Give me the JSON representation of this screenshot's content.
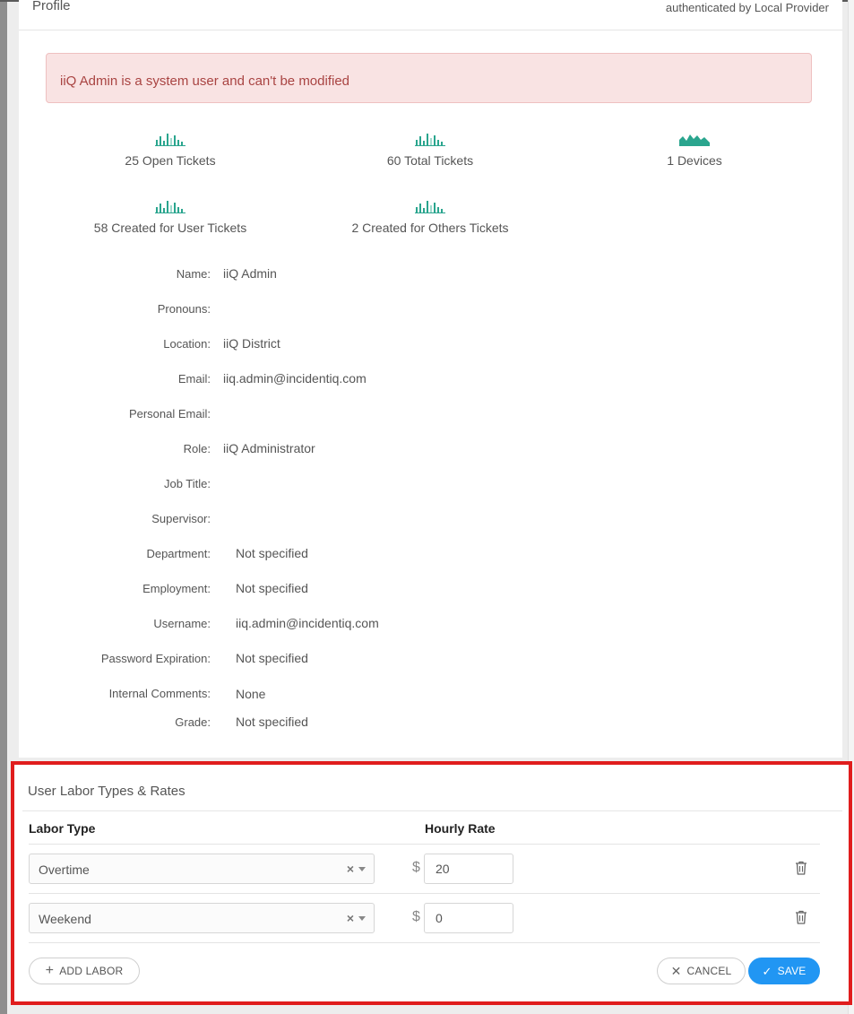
{
  "profile": {
    "title": "Profile",
    "auth": "authenticated by Local Provider",
    "alert": "iiQ Admin is a system user and can't be modified"
  },
  "stats": [
    {
      "label": "25 Open Tickets",
      "icon": "bar-chart-icon"
    },
    {
      "label": "60 Total Tickets",
      "icon": "bar-chart-icon"
    },
    {
      "label": "1 Devices",
      "icon": "area-chart-icon"
    },
    {
      "label": "58 Created for User Tickets",
      "icon": "bar-chart-icon"
    },
    {
      "label": "2 Created for Others Tickets",
      "icon": "bar-chart-icon"
    }
  ],
  "fields": [
    {
      "label": "Name:",
      "value": "iiQ Admin"
    },
    {
      "label": "Pronouns:",
      "value": ""
    },
    {
      "label": "Location:",
      "value": "iiQ District"
    },
    {
      "label": "Email:",
      "value": "iiq.admin@incidentiq.com"
    },
    {
      "label": "Personal Email:",
      "value": ""
    },
    {
      "label": "Role:",
      "value": "iiQ Administrator"
    },
    {
      "label": "Job Title:",
      "value": ""
    },
    {
      "label": "Supervisor:",
      "value": ""
    },
    {
      "label": "Department:",
      "value": "Not specified"
    },
    {
      "label": "Employment:",
      "value": "Not specified"
    },
    {
      "label": "Username:",
      "value": "iiq.admin@incidentiq.com"
    },
    {
      "label": "Password Expiration:",
      "value": "Not specified"
    },
    {
      "label": "Internal Comments:",
      "value": "None"
    },
    {
      "label": "Grade:",
      "value": "Not specified"
    }
  ],
  "labor": {
    "title": "User Labor Types & Rates",
    "col_type": "Labor Type",
    "col_rate": "Hourly Rate",
    "currency": "$",
    "rows": [
      {
        "type": "Overtime",
        "rate": "20"
      },
      {
        "type": "Weekend",
        "rate": "0"
      }
    ],
    "add_label": "ADD LABOR",
    "cancel_label": "CANCEL",
    "save_label": "SAVE"
  },
  "colors": {
    "accent": "#2196f3",
    "chart_icon": "#2aa58e",
    "alert_bg": "#f9e3e3",
    "alert_text": "#a94442",
    "highlight_border": "#e01d1d"
  }
}
